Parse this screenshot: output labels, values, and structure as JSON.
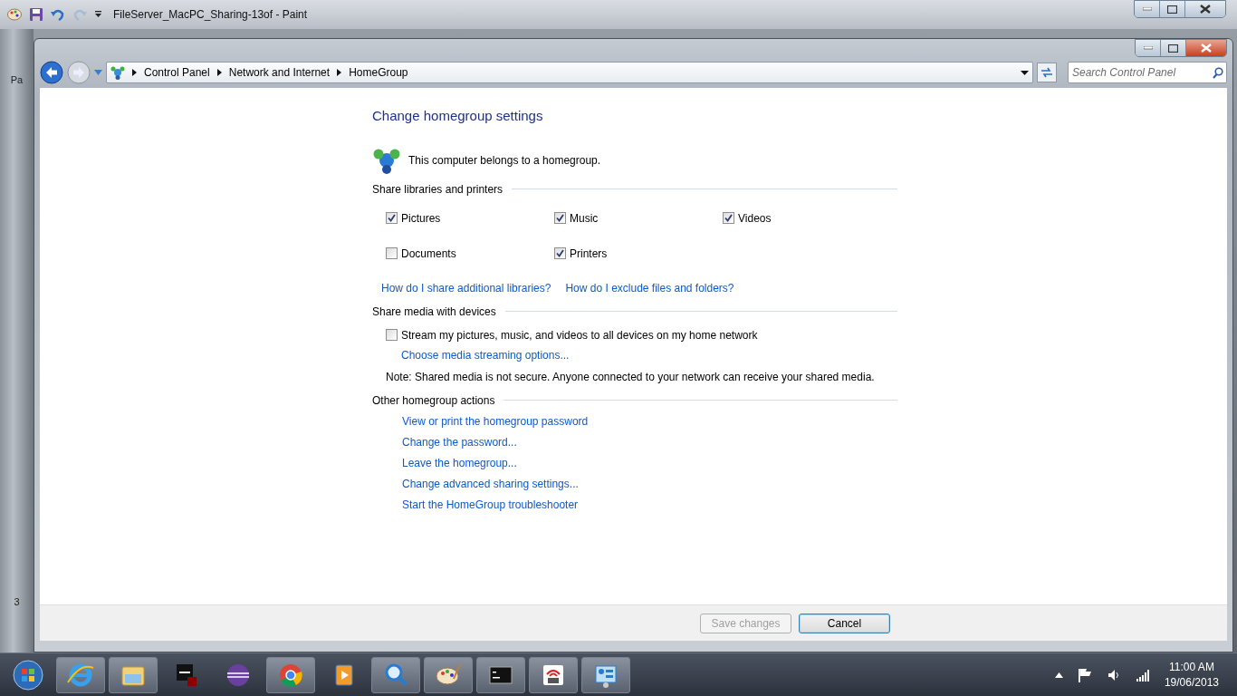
{
  "paint_window": {
    "title": "FileServer_MacPC_Sharing-13of - Paint",
    "fragments": [
      "Pa",
      "3"
    ]
  },
  "control_panel": {
    "breadcrumb": [
      "Control Panel",
      "Network and Internet",
      "HomeGroup"
    ],
    "search": {
      "placeholder": "Search Control Panel"
    },
    "heading": "Change homegroup settings",
    "status_text": "This computer belongs to a homegroup.",
    "libraries": {
      "title": "Share libraries and printers",
      "items": [
        {
          "label": "Pictures",
          "checked": true
        },
        {
          "label": "Music",
          "checked": true
        },
        {
          "label": "Videos",
          "checked": true
        },
        {
          "label": "Documents",
          "checked": false
        },
        {
          "label": "Printers",
          "checked": true
        }
      ],
      "links": [
        "How do I share additional libraries?",
        "How do I exclude files and folders?"
      ]
    },
    "media": {
      "title": "Share media with devices",
      "stream": {
        "label": "Stream my pictures, music, and videos to all devices on my home network",
        "checked": false
      },
      "link": "Choose media streaming options...",
      "note": "Note: Shared media is not secure. Anyone connected to your network can receive your shared media."
    },
    "other": {
      "title": "Other homegroup actions",
      "links": [
        "View or print the homegroup password",
        "Change the password...",
        "Leave the homegroup...",
        "Change advanced sharing settings...",
        "Start the HomeGroup troubleshooter"
      ]
    },
    "buttons": [
      {
        "label": "Save changes",
        "disabled": true
      },
      {
        "label": "Cancel",
        "disabled": false
      }
    ]
  },
  "taskbar": {
    "time": "11:00 AM",
    "date": "19/06/2013"
  }
}
